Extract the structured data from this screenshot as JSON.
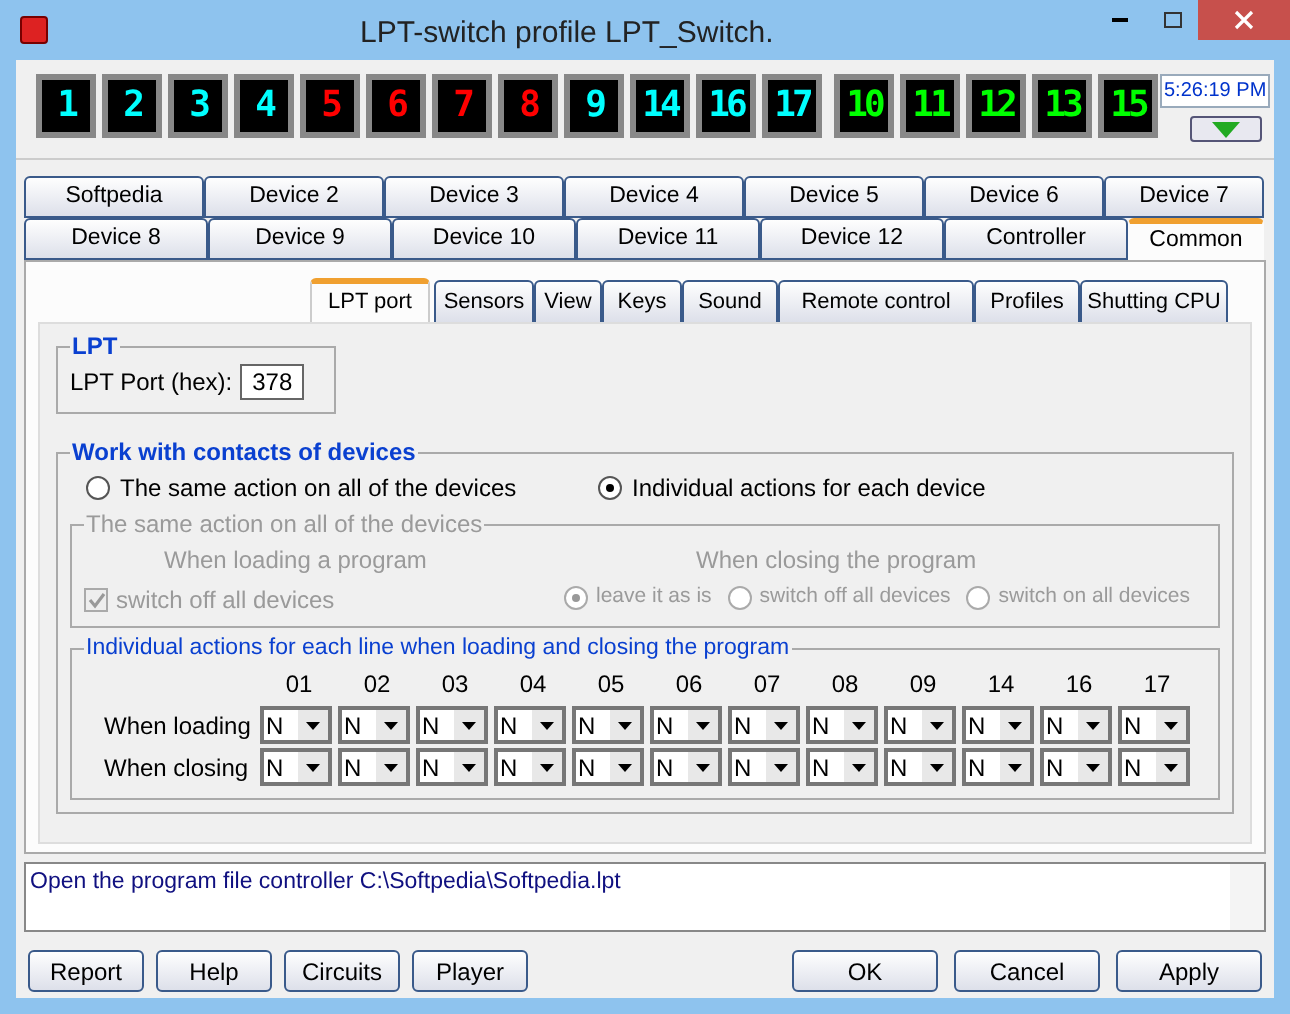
{
  "window": {
    "title": "LPT-switch profile LPT_Switch."
  },
  "indicator_groups": [
    [
      {
        "label": "1",
        "color": "#00ffff"
      },
      {
        "label": "2",
        "color": "#00ffff"
      },
      {
        "label": "3",
        "color": "#00ffff"
      },
      {
        "label": "4",
        "color": "#00ffff"
      },
      {
        "label": "5",
        "color": "#ff0000"
      },
      {
        "label": "6",
        "color": "#ff0000"
      },
      {
        "label": "7",
        "color": "#ff0000"
      },
      {
        "label": "8",
        "color": "#ff0000"
      },
      {
        "label": "9",
        "color": "#00ffff"
      },
      {
        "label": "14",
        "color": "#00ffff"
      },
      {
        "label": "16",
        "color": "#00ffff"
      },
      {
        "label": "17",
        "color": "#00ffff"
      }
    ],
    [
      {
        "label": "10",
        "color": "#00ff00"
      },
      {
        "label": "11",
        "color": "#00ff00"
      },
      {
        "label": "12",
        "color": "#00ff00"
      },
      {
        "label": "13",
        "color": "#00ff00"
      },
      {
        "label": "15",
        "color": "#00ff00"
      }
    ]
  ],
  "clock": "5:26:19 PM",
  "device_tab_rows": [
    [
      {
        "label": "Softpedia",
        "selected": false
      },
      {
        "label": "Device 2",
        "selected": false
      },
      {
        "label": "Device 3",
        "selected": false
      },
      {
        "label": "Device 4",
        "selected": false
      },
      {
        "label": "Device 5",
        "selected": false
      },
      {
        "label": "Device 6",
        "selected": false
      },
      {
        "label": "Device 7",
        "selected": false
      }
    ],
    [
      {
        "label": "Device 8",
        "selected": false
      },
      {
        "label": "Device 9",
        "selected": false
      },
      {
        "label": "Device 10",
        "selected": false
      },
      {
        "label": "Device 11",
        "selected": false
      },
      {
        "label": "Device 12",
        "selected": false
      },
      {
        "label": "Controller",
        "selected": false
      },
      {
        "label": "Common",
        "selected": true
      }
    ]
  ],
  "sub_tabs": [
    {
      "label": "LPT port",
      "selected": true
    },
    {
      "label": "Sensors",
      "selected": false
    },
    {
      "label": "View",
      "selected": false
    },
    {
      "label": "Keys",
      "selected": false
    },
    {
      "label": "Sound",
      "selected": false
    },
    {
      "label": "Remote control",
      "selected": false
    },
    {
      "label": "Profiles",
      "selected": false
    },
    {
      "label": "Shutting CPU",
      "selected": false
    }
  ],
  "lpt": {
    "title": "LPT",
    "label": "LPT Port (hex):",
    "value": "378"
  },
  "contacts": {
    "title": "Work with contacts of devices",
    "modes": [
      {
        "label": "The same action on all of the devices",
        "selected": false
      },
      {
        "label": "Individual actions for each device",
        "selected": true
      }
    ],
    "same_action": {
      "title": "The same action on all of the devices",
      "disabled": true,
      "loading_title": "When loading a program",
      "loading_option": {
        "label": "switch off all devices",
        "checked": true
      },
      "closing_title": "When closing the program",
      "closing_options": [
        {
          "label": "leave it as is",
          "selected": true
        },
        {
          "label": "switch off all devices",
          "selected": false
        },
        {
          "label": "switch on all devices",
          "selected": false
        }
      ]
    },
    "individual": {
      "title": "Individual actions for each line when loading and closing the program",
      "lines": [
        "01",
        "02",
        "03",
        "04",
        "05",
        "06",
        "07",
        "08",
        "09",
        "14",
        "16",
        "17"
      ],
      "rows": [
        {
          "label": "When loading",
          "values": [
            "N",
            "N",
            "N",
            "N",
            "N",
            "N",
            "N",
            "N",
            "N",
            "N",
            "N",
            "N"
          ]
        },
        {
          "label": "When closing",
          "values": [
            "N",
            "N",
            "N",
            "N",
            "N",
            "N",
            "N",
            "N",
            "N",
            "N",
            "N",
            "N"
          ]
        }
      ]
    }
  },
  "log": "Open the program file controller C:\\Softpedia\\Softpedia.lpt",
  "buttons_left": [
    "Report",
    "Help",
    "Circuits",
    "Player"
  ],
  "buttons_right": [
    "OK",
    "Cancel",
    "Apply"
  ]
}
